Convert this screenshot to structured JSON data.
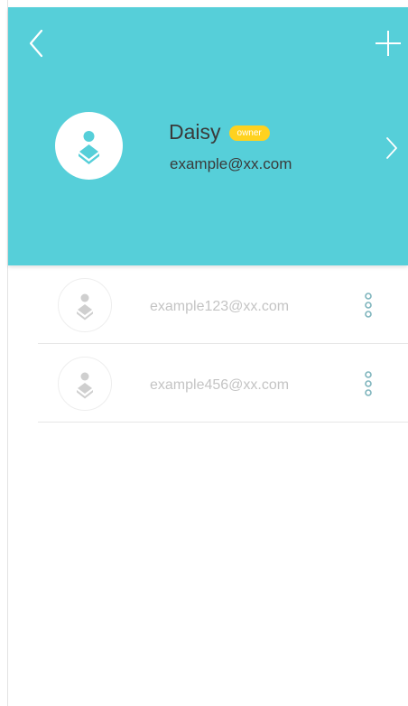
{
  "header": {
    "back_icon": "chevron-left-icon",
    "add_icon": "plus-icon",
    "background_color": "#56cfd9"
  },
  "owner": {
    "name": "Daisy",
    "badge": "owner",
    "email": "example@xx.com",
    "badge_color": "#ffd21f",
    "avatar_icon": "user-avatar-icon",
    "chevron_icon": "chevron-right-icon"
  },
  "members": [
    {
      "email": "example123@xx.com",
      "avatar_icon": "user-avatar-icon",
      "menu_icon": "more-vertical-icon"
    },
    {
      "email": "example456@xx.com",
      "avatar_icon": "user-avatar-icon",
      "menu_icon": "more-vertical-icon"
    }
  ]
}
